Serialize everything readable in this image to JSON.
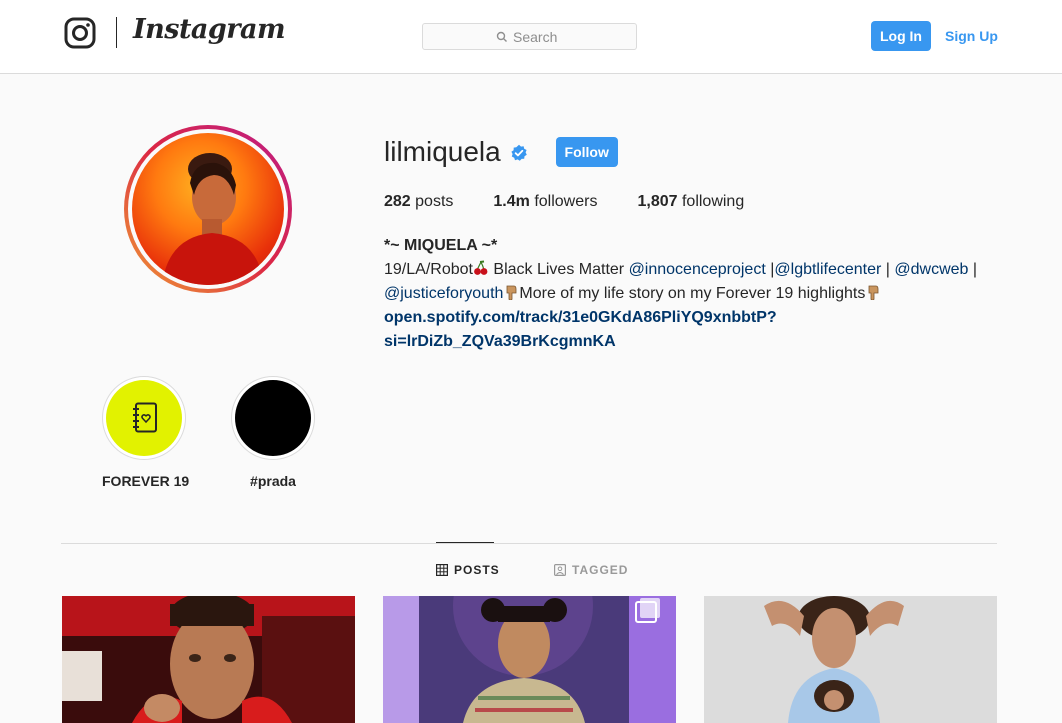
{
  "header": {
    "brand": "Instagram",
    "search_placeholder": "Search",
    "login_label": "Log In",
    "signup_label": "Sign Up"
  },
  "profile": {
    "username": "lilmiquela",
    "follow_label": "Follow",
    "stats": {
      "posts_count": "282",
      "posts_label": "posts",
      "followers_count": "1.4m",
      "followers_label": "followers",
      "following_count": "1,807",
      "following_label": "following"
    },
    "bio": {
      "name": "*~ MIQUELA ~*",
      "line1_a": "19/LA/Robot",
      "line1_b": " Black Lives Matter ",
      "mention1": "@innocenceproject",
      "sep1": " |",
      "mention2": "@lgbtlifecenter",
      "sep2": " | ",
      "mention3": "@dwcweb",
      "sep3": " |",
      "mention4": "@justiceforyouth",
      "line2_b": "More of my life story on my Forever 19 highlights",
      "link": "open.spotify.com/track/31e0GKdA86PliYQ9xnbbtP?si=lrDiZb_ZQVa39BrKcgmnKA"
    }
  },
  "highlights": [
    {
      "label": "FOREVER 19",
      "color": "#e2f200",
      "icon": "notebook-heart-icon"
    },
    {
      "label": "#prada",
      "color": "#000000"
    }
  ],
  "tabs": [
    {
      "label": "POSTS",
      "icon": "grid-icon",
      "active": true
    },
    {
      "label": "TAGGED",
      "icon": "tag-icon",
      "active": false
    }
  ],
  "colors": {
    "accent": "#3897f0",
    "link": "#003569",
    "border": "#dbdbdb",
    "background": "#fafafa"
  }
}
